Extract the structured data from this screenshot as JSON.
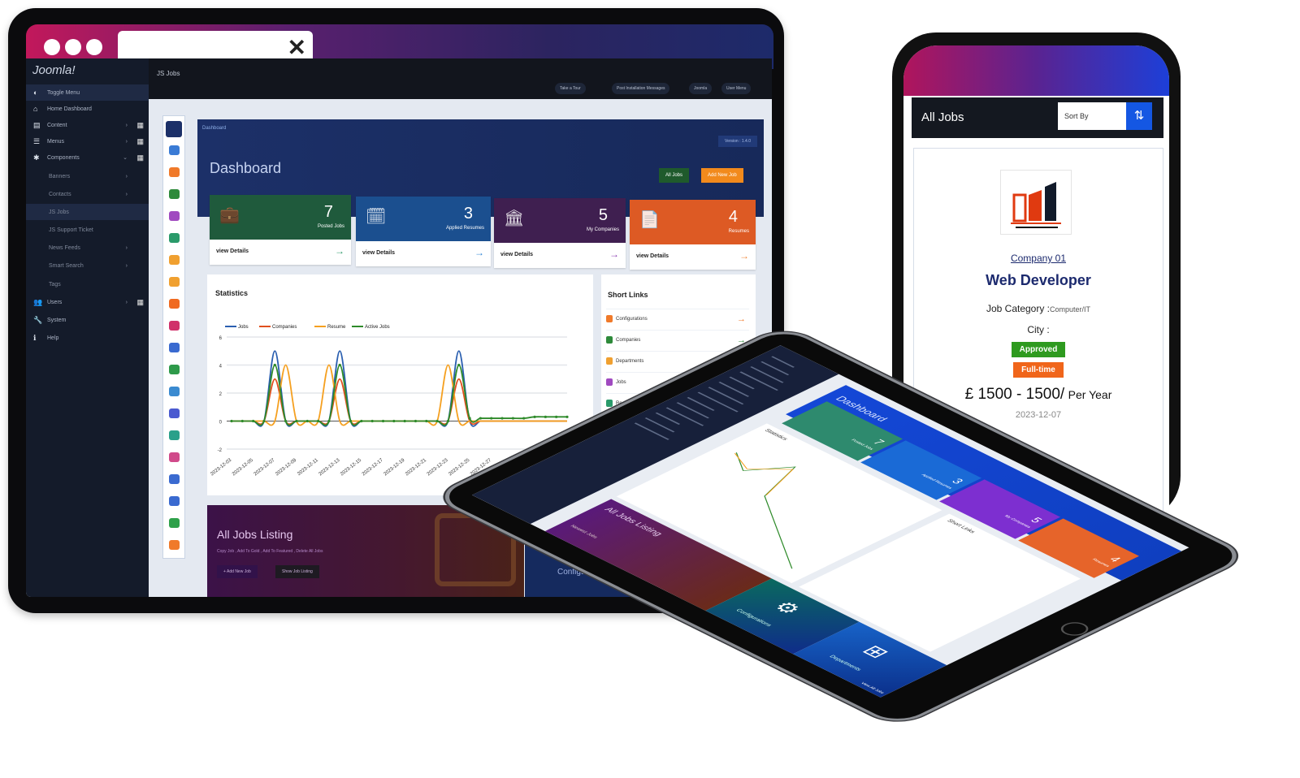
{
  "laptop": {
    "brand": "Joomla!",
    "close_icon": "✕",
    "topbar": {
      "site_title": "JS Jobs",
      "pills": [
        "Take a Tour",
        "Post Installation Messages",
        "Joomla",
        "User Menu"
      ]
    },
    "sidebar": {
      "items": [
        {
          "label": "Toggle Menu",
          "icon": "◐"
        },
        {
          "label": "Home Dashboard",
          "icon": "⌂"
        },
        {
          "label": "Content",
          "icon": "▤"
        },
        {
          "label": "Menus",
          "icon": "☰"
        },
        {
          "label": "Components",
          "icon": "✱"
        },
        {
          "label": "Banners"
        },
        {
          "label": "Contacts"
        },
        {
          "label": "JS Jobs"
        },
        {
          "label": "JS Support Ticket"
        },
        {
          "label": "News Feeds"
        },
        {
          "label": "Smart Search"
        },
        {
          "label": "Tags"
        },
        {
          "label": "Users",
          "icon": "👥"
        },
        {
          "label": "System",
          "icon": "🔧"
        },
        {
          "label": "Help",
          "icon": "ℹ"
        }
      ]
    },
    "dashboard": {
      "breadcrumb": "Dashboard",
      "title": "Dashboard",
      "version": "Version : 1.4.0",
      "all_jobs_button": "All Jobs",
      "add_new_job_button": "Add New Job",
      "tiles": [
        {
          "value": "7",
          "label": "Posted Jobs",
          "link": "view Details",
          "color": "#1f5a3c",
          "arrow_color": "#2e9a6a"
        },
        {
          "value": "3",
          "label": "Applied Resumes",
          "link": "view Details",
          "color": "#1b4f8f",
          "arrow_color": "#2f86d6"
        },
        {
          "value": "5",
          "label": "My Companies",
          "link": "view Details",
          "color": "#3f1f50",
          "arrow_color": "#8a3cb0"
        },
        {
          "value": "4",
          "label": "Resumes",
          "link": "view Details",
          "color": "#dd5a24",
          "arrow_color": "#f0883a"
        }
      ],
      "statistics_title": "Statistics",
      "short_links": {
        "title": "Short Links",
        "items": [
          "Configurations",
          "Companies",
          "Departments",
          "Jobs",
          "Re..."
        ]
      },
      "listing": {
        "title": "All Jobs Listing",
        "subtitle": "Copy Job , Add To Gold , Add To Featured , Delete All Jobs",
        "add_button": "+ Add New Job",
        "show_button": "Show Job Listing"
      },
      "config_tile": "Configurations"
    }
  },
  "phone": {
    "header_title": "All Jobs",
    "sort_placeholder": "Sort By",
    "sort_icon": "sort-ascending",
    "company": "Company 01",
    "job_title": "Web Developer",
    "category_label": "Job Category :",
    "category_value": "Computer/IT",
    "city_label": "City :",
    "status_badge": "Approved",
    "type_badge": "Full-time",
    "salary": "£ 1500 - 1500/",
    "salary_period": "Per Year",
    "date": "2023-12-07",
    "colors": {
      "approved": "#2e9a1f",
      "fulltime": "#f0651a",
      "title": "#1c2a6e"
    }
  },
  "tablet": {
    "title": "Dashboard",
    "statistics": "Statistics",
    "short_links": "Short Links",
    "listing_title": "All Jobs Listing",
    "configurations": "Configurations",
    "departments": "Departments",
    "newest_jobs": "Newest Jobs",
    "view_all": "View All Jobs",
    "tiles": [
      {
        "value": "7",
        "label": "Posted Jobs",
        "color": "#2e8a6e"
      },
      {
        "value": "3",
        "label": "Applied Resumes",
        "color": "#1a6ad6"
      },
      {
        "value": "5",
        "label": "My Companies",
        "color": "#7d2fd0"
      },
      {
        "value": "4",
        "label": "Resumes",
        "color": "#e6642a"
      }
    ]
  },
  "chart_data": {
    "type": "line",
    "title": "",
    "xlabel": "",
    "ylabel": "",
    "ylim": [
      -2,
      6
    ],
    "yticks": [
      -2,
      0,
      2,
      4,
      6
    ],
    "grid": true,
    "legend": "top-left",
    "x": [
      "2023-12-03",
      "2023-12-04",
      "2023-12-05",
      "2023-12-06",
      "2023-12-07",
      "2023-12-08",
      "2023-12-09",
      "2023-12-10",
      "2023-12-11",
      "2023-12-12",
      "2023-12-13",
      "2023-12-14",
      "2023-12-15",
      "2023-12-16",
      "2023-12-17",
      "2023-12-18",
      "2023-12-19",
      "2023-12-20",
      "2023-12-21",
      "2023-12-22",
      "2023-12-23",
      "2023-12-24",
      "2023-12-25",
      "2023-12-26",
      "2023-12-27",
      "2023-12-28",
      "2023-12-29",
      "2023-12-30",
      "2023-12-31",
      "2024-01-01",
      "2024-01-02",
      "2024-01-03"
    ],
    "xtick_labels": [
      "2023-12-03",
      "2023-12-05",
      "2023-12-07",
      "2023-12-09",
      "2023-12-11",
      "2023-12-13",
      "2023-12-15",
      "2023-12-17",
      "2023-12-19",
      "2023-12-21",
      "2023-12-23",
      "2023-12-25",
      "2023-12-27"
    ],
    "series": [
      {
        "name": "Jobs",
        "color": "#2b5fb0",
        "values": [
          0,
          0,
          0,
          0,
          5,
          0,
          0,
          0,
          0,
          0,
          5,
          0,
          0,
          0,
          0,
          0,
          0,
          0,
          0,
          0,
          0,
          5,
          0,
          0,
          0,
          0,
          0,
          0,
          0,
          0,
          0,
          0
        ]
      },
      {
        "name": "Companies",
        "color": "#e0501e",
        "values": [
          0,
          0,
          0,
          0,
          3,
          0,
          0,
          0,
          0,
          0,
          3,
          0,
          0,
          0,
          0,
          0,
          0,
          0,
          0,
          0,
          0,
          3,
          0,
          0,
          0,
          0,
          0,
          0,
          0,
          0,
          0,
          0
        ]
      },
      {
        "name": "Resume",
        "color": "#f5a020",
        "values": [
          0,
          0,
          0,
          0,
          0,
          4,
          0,
          0,
          0,
          4,
          0,
          0,
          0,
          0,
          0,
          0,
          0,
          0,
          0,
          0,
          4,
          0,
          0,
          0,
          0,
          0,
          0,
          0,
          0,
          0,
          0,
          0
        ]
      },
      {
        "name": "Active Jobs",
        "color": "#2e8a2a",
        "values": [
          0,
          0,
          0,
          0,
          4,
          0,
          0,
          0,
          0,
          0,
          4,
          0,
          0,
          0,
          0,
          0,
          0,
          0,
          0,
          0,
          0,
          4,
          0.2,
          0.2,
          0.2,
          0.2,
          0.2,
          0.2,
          0.3,
          0.3,
          0.3,
          0.3
        ]
      }
    ]
  }
}
